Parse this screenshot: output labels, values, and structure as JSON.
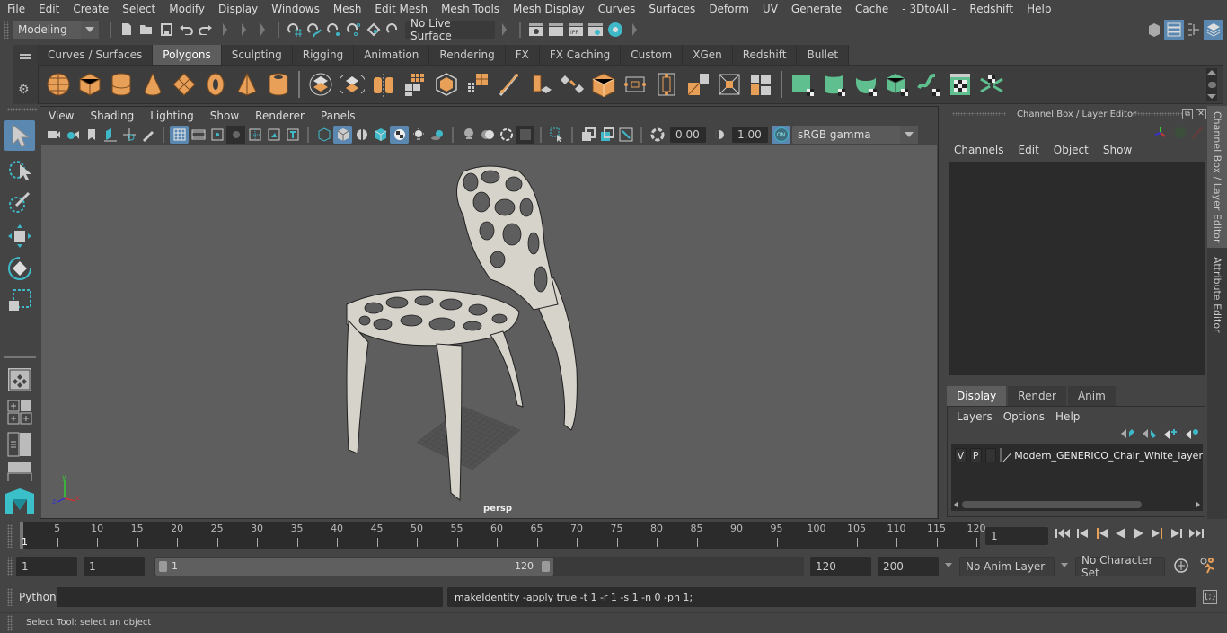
{
  "menubar": {
    "items": [
      "File",
      "Edit",
      "Create",
      "Select",
      "Modify",
      "Display",
      "Windows",
      "Mesh",
      "Edit Mesh",
      "Mesh Tools",
      "Mesh Display",
      "Curves",
      "Surfaces",
      "Deform",
      "UV",
      "Generate",
      "Cache",
      "- 3DtoAll -",
      "Redshift",
      "Help"
    ]
  },
  "statusline": {
    "mode": "Modeling",
    "live_surface": "No Live Surface",
    "icons": [
      "new-scene-icon",
      "open-scene-icon",
      "save-scene-icon",
      "undo-icon",
      "redo-icon",
      "select-hierarchy-icon",
      "select-object-icon",
      "select-component-icon",
      "snap-grid-icon",
      "snap-curve-icon",
      "snap-point-icon",
      "snap-view-icon",
      "snap-live-icon",
      "render-view-icon",
      "render-current-icon",
      "ipr-render-icon",
      "render-settings-icon",
      "hypershade-icon"
    ],
    "right_icons": [
      "modeling-toolkit-icon",
      "channel-box-toggle-icon",
      "outliner-toggle-icon",
      "attribute-editor-toggle-icon"
    ]
  },
  "shelf": {
    "tabs": [
      "Curves / Surfaces",
      "Polygons",
      "Sculpting",
      "Rigging",
      "Animation",
      "Rendering",
      "FX",
      "FX Caching",
      "Custom",
      "XGen",
      "Redshift",
      "Bullet"
    ],
    "active_tab": "Polygons",
    "tools_group1": [
      "poly-sphere",
      "poly-cube",
      "poly-cylinder",
      "poly-cone",
      "poly-plane",
      "poly-torus",
      "poly-pyramid",
      "poly-pipe"
    ],
    "tools_group2": [
      "combine",
      "separate",
      "mirror",
      "smooth",
      "boolean",
      "reduce",
      "multi-cut",
      "extrude",
      "bridge",
      "bevel",
      "edge-loop",
      "insert-edge-loop",
      "append-to-polygon",
      "fill-hole",
      "merge-vertex"
    ],
    "tools_group3": [
      "planar-uv",
      "cylindrical-uv",
      "spherical-uv",
      "automatic-uv",
      "unfold-uv",
      "uv-editor",
      "layout-uv"
    ]
  },
  "toolbox": {
    "tools": [
      "select-tool",
      "lasso-tool",
      "paint-select-tool",
      "move-tool",
      "rotate-tool",
      "scale-tool"
    ],
    "active": "select-tool",
    "layouts": [
      "single-perspective-layout",
      "four-view-layout",
      "persp-outliner-layout",
      "persp-graph-layout"
    ]
  },
  "viewport": {
    "menu": [
      "View",
      "Shading",
      "Lighting",
      "Show",
      "Renderer",
      "Panels"
    ],
    "exposure": "0.00",
    "gamma": "1.00",
    "color_mgmt_on": "ON",
    "color_space": "sRGB gamma",
    "camera_label": "persp",
    "axis": {
      "x": "x",
      "y": "y",
      "z": "z"
    }
  },
  "channelbox": {
    "title": "Channel Box / Layer Editor",
    "menu": [
      "Channels",
      "Edit",
      "Object",
      "Show"
    ]
  },
  "layereditor": {
    "tabs": [
      "Display",
      "Render",
      "Anim"
    ],
    "active_tab": "Display",
    "menu": [
      "Layers",
      "Options",
      "Help"
    ],
    "layers": [
      {
        "visible": "V",
        "playback": "P",
        "type": "",
        "name": "Modern_GENERICO_Chair_White_layer"
      }
    ]
  },
  "side_tabs": [
    "Channel Box / Layer Editor",
    "Attribute Editor"
  ],
  "timeline": {
    "ticks": [
      5,
      10,
      15,
      20,
      25,
      30,
      35,
      40,
      45,
      50,
      55,
      60,
      65,
      70,
      75,
      80,
      85,
      90,
      95,
      100,
      105,
      110,
      115,
      120
    ],
    "start": 1,
    "end": 120,
    "current_frame_display": "1",
    "current_frame_field": "1"
  },
  "range": {
    "start_field": "1",
    "playback_start": "1",
    "slider_start": "1",
    "slider_end": "120",
    "playback_end": "120",
    "end_field": "200",
    "anim_layer": "No Anim Layer",
    "character_set": "No Character Set"
  },
  "playback_controls": [
    "go-to-start-icon",
    "step-back-frame-icon",
    "step-back-key-icon",
    "play-backwards-icon",
    "play-forwards-icon",
    "step-forward-key-icon",
    "step-forward-frame-icon",
    "go-to-end-icon"
  ],
  "commandline": {
    "language": "Python",
    "input": "",
    "result": "makeIdentity -apply true -t 1 -r 1 -s 1 -n 0 -pn 1;"
  },
  "helpline": {
    "text": "Select Tool: select an object"
  },
  "colors": {
    "accent_blue": "#5a88b0",
    "shelf_orange": "#e8a058",
    "shelf_green": "#5fbf8f",
    "teal": "#3fb8c8",
    "viewport_bg": "#5e5e5e"
  }
}
